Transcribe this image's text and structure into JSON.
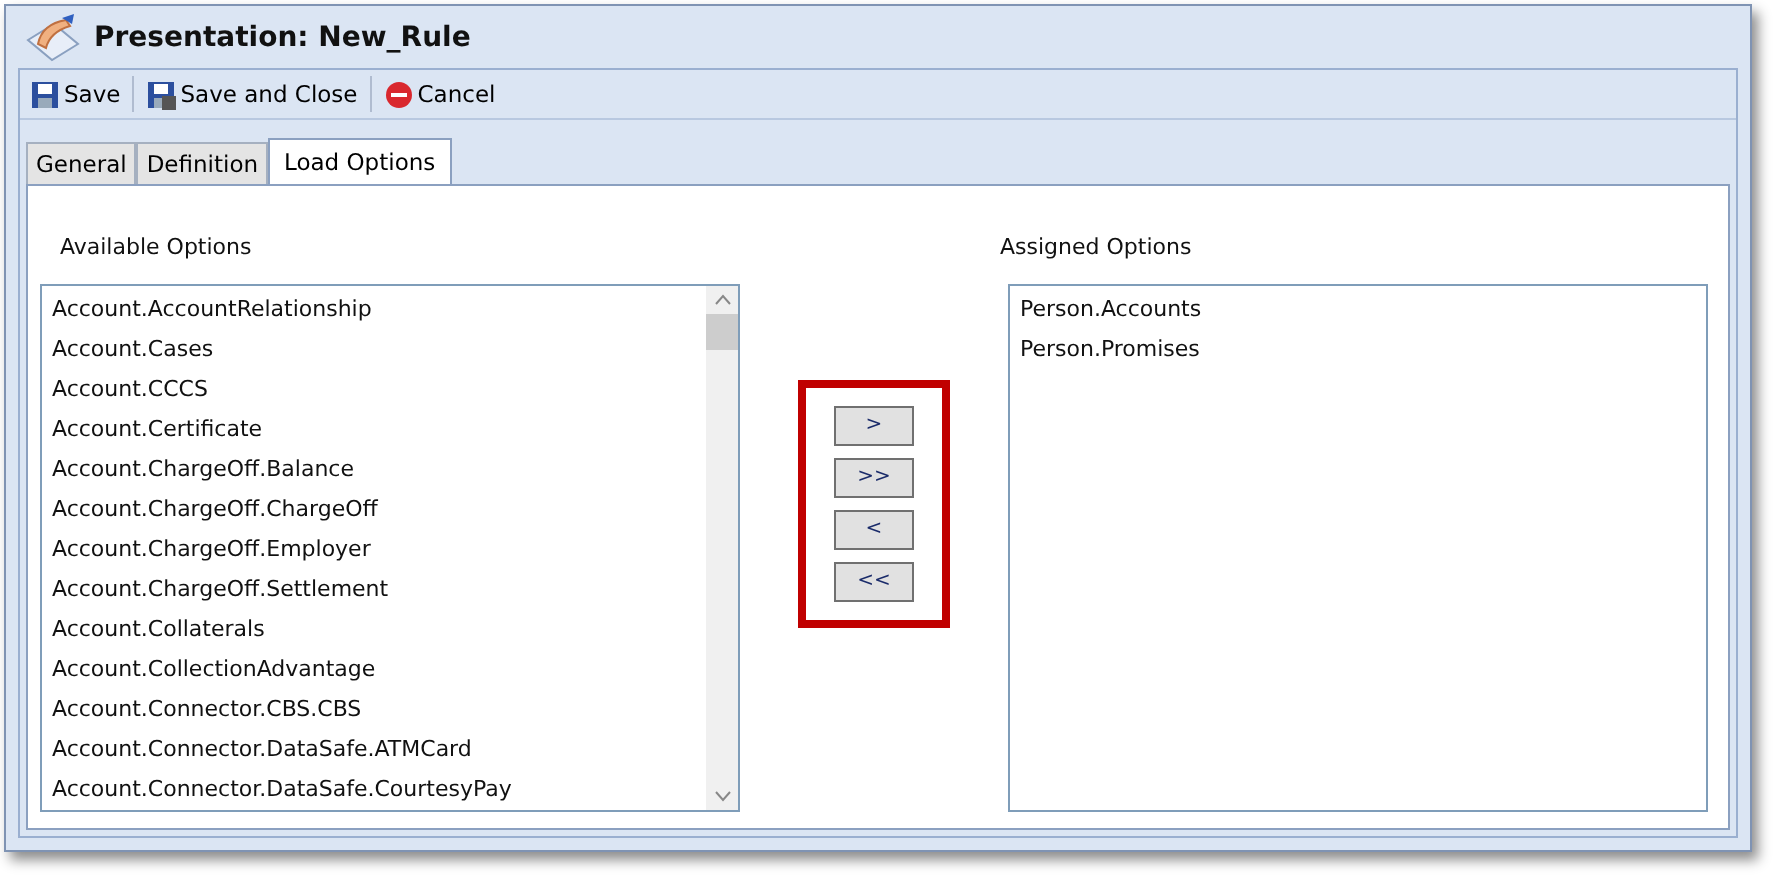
{
  "window": {
    "title": "Presentation: New_Rule"
  },
  "toolbar": [
    {
      "kind": "save",
      "label": "Save"
    },
    {
      "kind": "save_close",
      "label": "Save and Close"
    },
    {
      "kind": "cancel",
      "label": "Cancel"
    }
  ],
  "tabs": [
    {
      "label": "General",
      "selected": false
    },
    {
      "label": "Definition",
      "selected": false
    },
    {
      "label": "Load Options",
      "selected": true
    }
  ],
  "available": {
    "label": "Available Options",
    "items": [
      "Account.AccountRelationship",
      "Account.Cases",
      "Account.CCCS",
      "Account.Certificate",
      "Account.ChargeOff.Balance",
      "Account.ChargeOff.ChargeOff",
      "Account.ChargeOff.Employer",
      "Account.ChargeOff.Settlement",
      "Account.Collaterals",
      "Account.CollectionAdvantage",
      "Account.Connector.CBS.CBS",
      "Account.Connector.DataSafe.ATMCard",
      "Account.Connector.DataSafe.CourtesyPay"
    ]
  },
  "move_buttons": [
    ">",
    ">>",
    "<",
    "<<"
  ],
  "assigned": {
    "label": "Assigned Options",
    "items": [
      "Person.Accounts",
      "Person.Promises"
    ]
  }
}
